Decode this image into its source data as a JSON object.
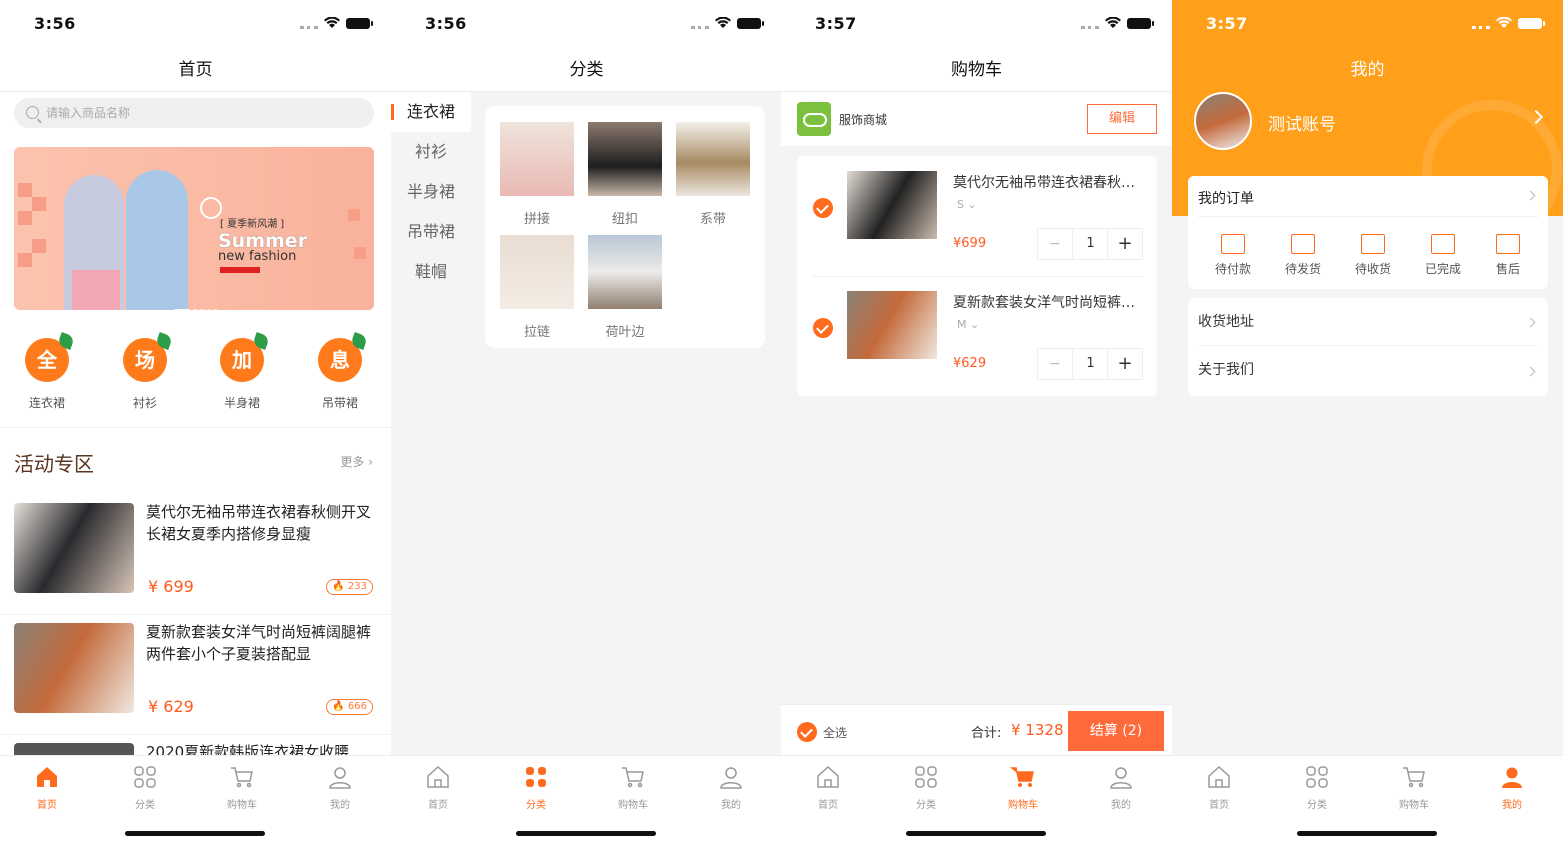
{
  "screens": {
    "home": {
      "time": "3:56",
      "title": "首页",
      "search_placeholder": "请输入商品名称",
      "banner": {
        "tag": "[ 夏季新风潮 ]",
        "headline": "Summer",
        "subline": "new fashion"
      },
      "categories": [
        {
          "icon_text": "全",
          "label": "连衣裙"
        },
        {
          "icon_text": "场",
          "label": "衬衫"
        },
        {
          "icon_text": "加",
          "label": "半身裙"
        },
        {
          "icon_text": "息",
          "label": "吊带裙"
        }
      ],
      "section_title": "活动专区",
      "more_label": "更多 ›",
      "products": [
        {
          "title": "莫代尔无袖吊带连衣裙春秋侧开叉长裙女夏季内搭修身显瘦",
          "price": "¥ 699",
          "badge": "233"
        },
        {
          "title": "夏新款套装女洋气时尚短裤阔腿裤两件套小个子夏装搭配显",
          "price": "¥ 629",
          "badge": "666"
        },
        {
          "title": "2020夏新款韩版连衣裙女收腰",
          "price": "",
          "badge": ""
        }
      ]
    },
    "category": {
      "time": "3:56",
      "title": "分类",
      "side_items": [
        "连衣裙",
        "衬衫",
        "半身裙",
        "吊带裙",
        "鞋帽"
      ],
      "grid_items": [
        "拼接",
        "纽扣",
        "系带",
        "拉链",
        "荷叶边"
      ]
    },
    "cart": {
      "time": "3:57",
      "title": "购物车",
      "shop_name": "服饰商城",
      "edit_label": "编辑",
      "items": [
        {
          "title": "莫代尔无袖吊带连衣裙春秋侧开叉长裙",
          "size": "S ⌄",
          "price": "¥699",
          "qty": "1"
        },
        {
          "title": "夏新款套装女洋气时尚短裤阔腿裤两件套",
          "size": "M ⌄",
          "price": "¥629",
          "qty": "1"
        }
      ],
      "minus": "−",
      "plus": "+",
      "select_all": "全选",
      "total_label": "合计:",
      "total_value": "¥ 1328",
      "checkout_label": "结算 (2)"
    },
    "mine": {
      "time": "3:57",
      "title": "我的",
      "username": "测试账号",
      "orders_title": "我的订单",
      "order_states": [
        "待付款",
        "待发货",
        "待收货",
        "已完成",
        "售后"
      ],
      "rows": [
        "收货地址",
        "关于我们"
      ]
    }
  },
  "tabs": [
    "首页",
    "分类",
    "购物车",
    "我的"
  ],
  "colors": {
    "accent": "#ff6a1f",
    "mine_header": "#ff9f1a",
    "price": "#ff5a1f"
  }
}
